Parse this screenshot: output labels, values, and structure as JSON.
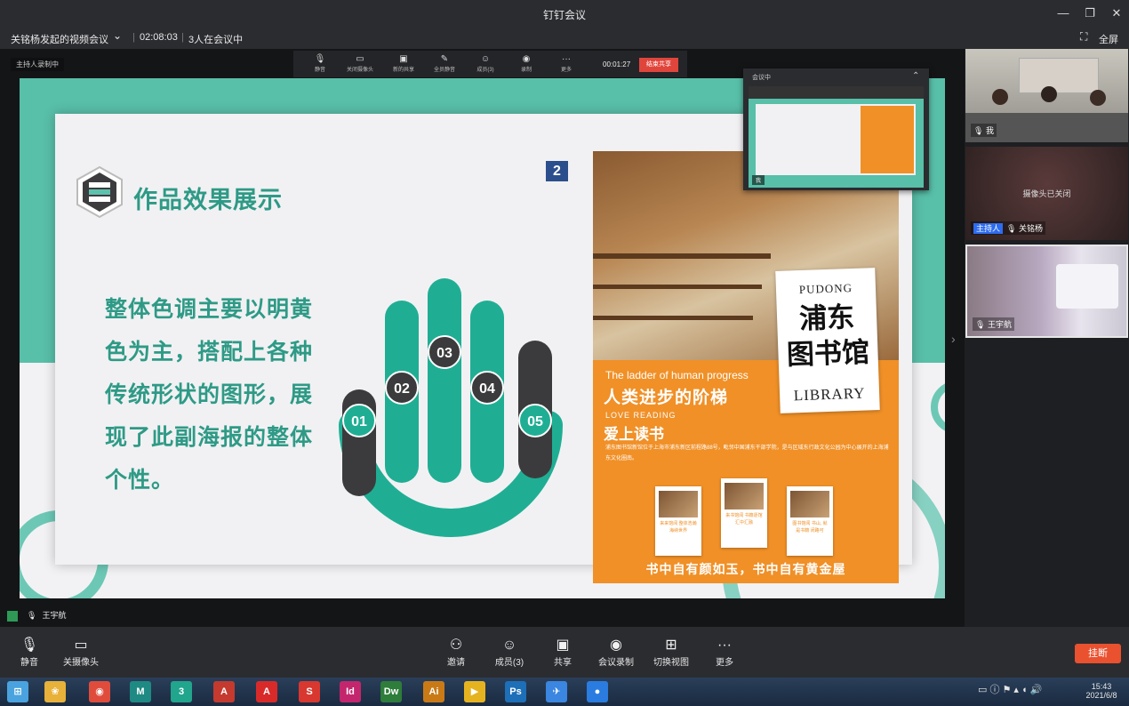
{
  "window": {
    "title": "钉钉会议",
    "min_glyph": "—",
    "max_glyph": "❐",
    "close_glyph": "✕"
  },
  "meeting": {
    "name": "关铭杨发起的视频会议",
    "elapsed": "02:08:03",
    "participants": "3人在会议中",
    "fullscreen_label": "全屏"
  },
  "share_toolbar": {
    "recording_badge": "主持人录制中",
    "items": [
      {
        "label": "静音",
        "icon": "mic-icon",
        "glyph": "🎙"
      },
      {
        "label": "关闭摄像头",
        "icon": "camera-icon",
        "glyph": "▭"
      },
      {
        "label": "新的共享",
        "icon": "share-icon",
        "glyph": "▣"
      },
      {
        "label": "全员静音",
        "icon": "mute-all-icon",
        "glyph": "✎"
      },
      {
        "label": "成员(3)",
        "icon": "members-icon",
        "glyph": "☺"
      },
      {
        "label": "录制",
        "icon": "record-icon",
        "glyph": "◉"
      },
      {
        "label": "更多",
        "icon": "more-icon",
        "glyph": "···"
      }
    ],
    "timer": "00:01:27",
    "end_share_label": "结束共享"
  },
  "slide": {
    "page_number": "2",
    "heading": "作品效果展示",
    "description": "整体色调主要以明黄色为主，搭配上各种传统形状的图形，展现了此副海报的整体个性。",
    "steps": [
      "01",
      "02",
      "03",
      "04",
      "05"
    ],
    "accent_color": "#2e9a86",
    "dark_color": "#3b3b3d"
  },
  "poster": {
    "pudong": "PUDONG",
    "title_line1": "浦东",
    "title_line2": "图书馆",
    "library": "LIBRARY",
    "tagline_en": "The ladder of human progress",
    "tagline_cn": "人类进步的阶梯",
    "love_en": "LOVE READING",
    "love_cn": "爱上读书",
    "body": "浦东图书馆新馆位于上海市浦东新区前程路88号，毗邻中国浦东干部学院，是与区域东行政文化公园为中心展开的上海浦东文化圈南。",
    "thumbs": [
      "来来馆阅 整体浩瀚 海纳世界",
      "来书馆阅 书籍逐馆 汇中汇融",
      "图书馆阅 书山, 就是书籍 闭路可"
    ],
    "footer": "书中自有颜如玉，书中自有黄金屋"
  },
  "self_preview": {
    "header": "会议中",
    "name": "我"
  },
  "speaker": {
    "name": "王宇航"
  },
  "participants_panel": [
    {
      "name": "我",
      "host": false,
      "camera_off": false
    },
    {
      "name": "关铭杨",
      "host": true,
      "host_label": "主持人",
      "camera_off": true,
      "camera_off_text": "摄像头已关闭"
    },
    {
      "name": "王宇航",
      "host": false,
      "camera_off": false
    }
  ],
  "toolbar": {
    "mute": "静音",
    "camera": "关摄像头",
    "invite": "邀请",
    "members": "成员(3)",
    "share": "共享",
    "record": "会议录制",
    "switch_view": "切换视图",
    "more": "更多",
    "hangup": "挂断"
  },
  "taskbar": {
    "time": "15:43",
    "date": "2021/6/8",
    "apps": [
      {
        "name": "start-button",
        "glyph": "⊞",
        "color": "#4aa3df"
      },
      {
        "name": "app-pinwheel",
        "glyph": "❀",
        "color": "#e8b13a"
      },
      {
        "name": "app-chrome",
        "glyph": "◉",
        "color": "#e04c3c"
      },
      {
        "name": "app-3dsmax",
        "glyph": "M",
        "color": "#1e8a83"
      },
      {
        "name": "app-3dsmax-alt",
        "glyph": "3",
        "color": "#21a58c"
      },
      {
        "name": "app-autocad",
        "glyph": "A",
        "color": "#c43a2f"
      },
      {
        "name": "app-acrobat",
        "glyph": "A",
        "color": "#d92a2a"
      },
      {
        "name": "app-sketchup",
        "glyph": "S",
        "color": "#d8382f"
      },
      {
        "name": "app-indesign",
        "glyph": "Id",
        "color": "#c4266d"
      },
      {
        "name": "app-dreamweaver",
        "glyph": "Dw",
        "color": "#2e7d3a"
      },
      {
        "name": "app-illustrator",
        "glyph": "Ai",
        "color": "#c97a17"
      },
      {
        "name": "app-potplayer",
        "glyph": "▶",
        "color": "#e6b320"
      },
      {
        "name": "app-photoshop",
        "glyph": "Ps",
        "color": "#1d6fb8"
      },
      {
        "name": "app-dingtalk",
        "glyph": "✈",
        "color": "#3a86e0"
      },
      {
        "name": "app-meeting",
        "glyph": "●",
        "color": "#2a7ce0"
      }
    ]
  }
}
